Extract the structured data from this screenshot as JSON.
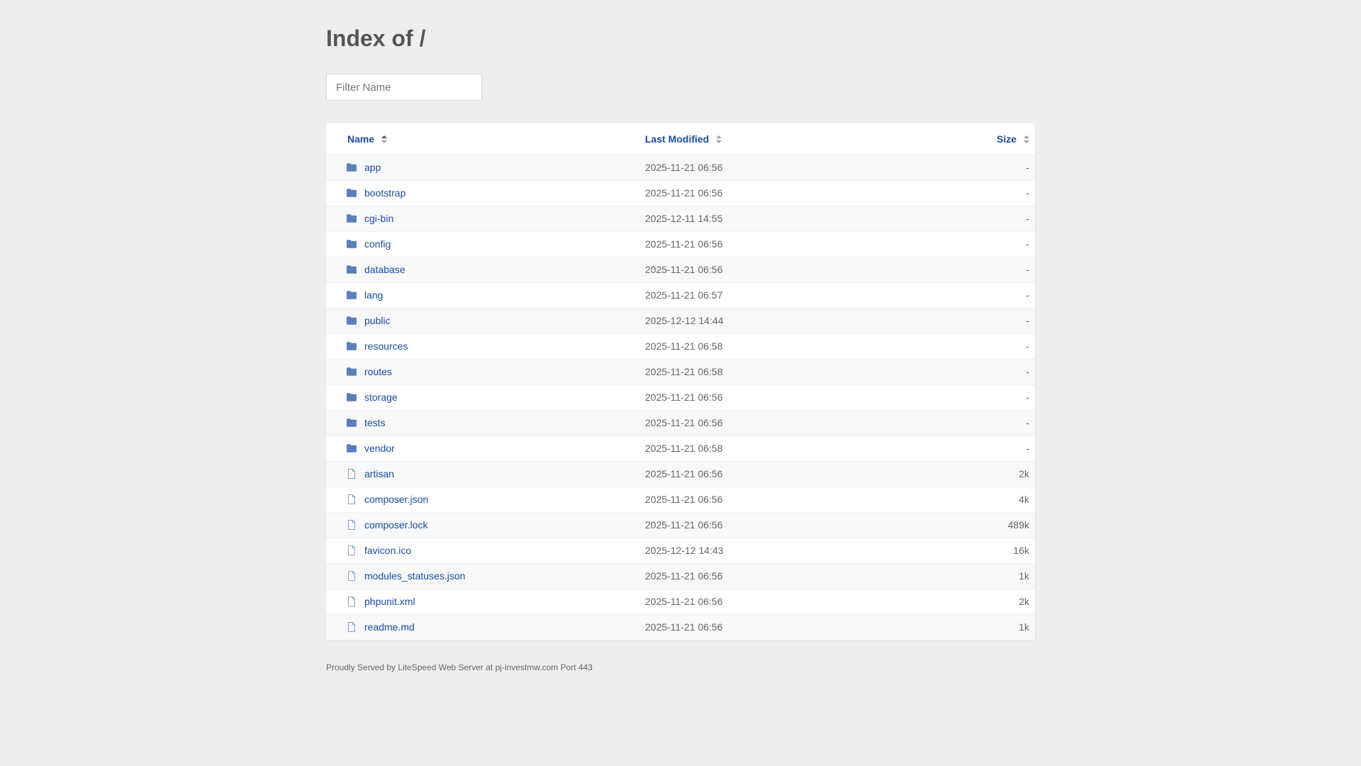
{
  "title": "Index of /",
  "filter": {
    "placeholder": "Filter Name",
    "value": ""
  },
  "columns": {
    "name": "Name",
    "modified": "Last Modified",
    "size": "Size"
  },
  "rows": [
    {
      "name": "app",
      "type": "folder",
      "modified": "2025-11-21 06:56",
      "size": "-"
    },
    {
      "name": "bootstrap",
      "type": "folder",
      "modified": "2025-11-21 06:56",
      "size": "-"
    },
    {
      "name": "cgi-bin",
      "type": "folder",
      "modified": "2025-12-11 14:55",
      "size": "-"
    },
    {
      "name": "config",
      "type": "folder",
      "modified": "2025-11-21 06:56",
      "size": "-"
    },
    {
      "name": "database",
      "type": "folder",
      "modified": "2025-11-21 06:56",
      "size": "-"
    },
    {
      "name": "lang",
      "type": "folder",
      "modified": "2025-11-21 06:57",
      "size": "-"
    },
    {
      "name": "public",
      "type": "folder",
      "modified": "2025-12-12 14:44",
      "size": "-"
    },
    {
      "name": "resources",
      "type": "folder",
      "modified": "2025-11-21 06:58",
      "size": "-"
    },
    {
      "name": "routes",
      "type": "folder",
      "modified": "2025-11-21 06:58",
      "size": "-"
    },
    {
      "name": "storage",
      "type": "folder",
      "modified": "2025-11-21 06:56",
      "size": "-"
    },
    {
      "name": "tests",
      "type": "folder",
      "modified": "2025-11-21 06:56",
      "size": "-"
    },
    {
      "name": "vendor",
      "type": "folder",
      "modified": "2025-11-21 06:58",
      "size": "-"
    },
    {
      "name": "artisan",
      "type": "file",
      "modified": "2025-11-21 06:56",
      "size": "2k"
    },
    {
      "name": "composer.json",
      "type": "file",
      "modified": "2025-11-21 06:56",
      "size": "4k"
    },
    {
      "name": "composer.lock",
      "type": "file",
      "modified": "2025-11-21 06:56",
      "size": "489k"
    },
    {
      "name": "favicon.ico",
      "type": "file",
      "modified": "2025-12-12 14:43",
      "size": "16k"
    },
    {
      "name": "modules_statuses.json",
      "type": "file",
      "modified": "2025-11-21 06:56",
      "size": "1k"
    },
    {
      "name": "phpunit.xml",
      "type": "file",
      "modified": "2025-11-21 06:56",
      "size": "2k"
    },
    {
      "name": "readme.md",
      "type": "file",
      "modified": "2025-11-21 06:56",
      "size": "1k"
    }
  ],
  "footer": "Proudly Served by LiteSpeed Web Server at pj-investmw.com Port 443",
  "colors": {
    "background": "#eceef0",
    "link": "#1a4b9f",
    "folder_icon": "#5b7fb8",
    "file_icon": "#8a9fc4"
  }
}
